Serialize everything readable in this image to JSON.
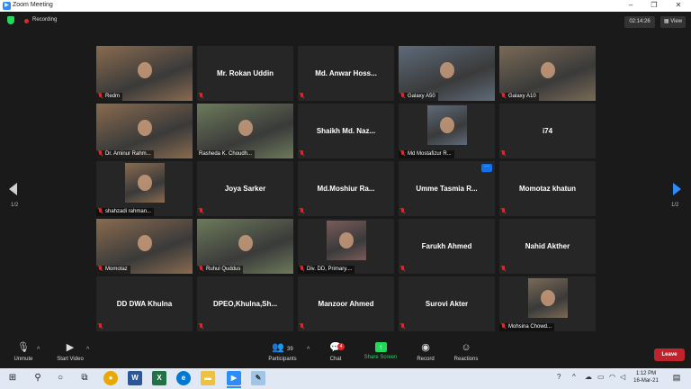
{
  "window": {
    "title": "Zoom Meeting"
  },
  "window_controls": {
    "minimize": "–",
    "restore": "❐",
    "close": "✕"
  },
  "status": {
    "recording_label": "Recording",
    "timer": "02:14:26",
    "view_label": "View",
    "view_icon": "grid-icon"
  },
  "gallery": {
    "page_left": "1/2",
    "page_right": "1/2",
    "tiles": [
      {
        "type": "video",
        "label": "Redm",
        "muted": true
      },
      {
        "type": "name",
        "name": "Mr. Rokan Uddin",
        "muted": true
      },
      {
        "type": "name",
        "name": "Md. Anwar Hoss...",
        "muted": true
      },
      {
        "type": "video",
        "label": "Galaxy A50",
        "muted": true
      },
      {
        "type": "video",
        "label": "Galaxy A10",
        "muted": true
      },
      {
        "type": "video",
        "label": "Dr. Aminur Rahm...",
        "muted": true
      },
      {
        "type": "video",
        "label": "Rasheda K. Choudh...",
        "muted": false,
        "active_speaker": true
      },
      {
        "type": "name",
        "name": "Shaikh  Md.  Naz...",
        "muted": true
      },
      {
        "type": "photo",
        "label": "Md Mostafizur R...",
        "muted": true
      },
      {
        "type": "name",
        "name": "i74",
        "muted": true
      },
      {
        "type": "photo",
        "label": "shahzadi rahman...",
        "muted": true
      },
      {
        "type": "name",
        "name": "Joya Sarker",
        "muted": true
      },
      {
        "type": "name",
        "name": "Md.Moshiur  Ra...",
        "muted": true
      },
      {
        "type": "name",
        "name": "Umme Tasmia R...",
        "muted": true,
        "more_button": "···"
      },
      {
        "type": "name",
        "name": "Momotaz khatun",
        "muted": true
      },
      {
        "type": "video",
        "label": "Momotaz",
        "muted": true
      },
      {
        "type": "video",
        "label": "Ruhul Quddus",
        "muted": true
      },
      {
        "type": "photo",
        "label": "Div. DD, Primary....",
        "muted": true
      },
      {
        "type": "name",
        "name": "Farukh Ahmed",
        "muted": true
      },
      {
        "type": "name",
        "name": "Nahid Akther",
        "muted": true
      },
      {
        "type": "name",
        "name": "DD DWA Khulna",
        "muted": true
      },
      {
        "type": "name",
        "name": "DPEO,Khulna,Sh...",
        "muted": true
      },
      {
        "type": "name",
        "name": "Manzoor Ahmed",
        "muted": true
      },
      {
        "type": "name",
        "name": "Surovi Akter",
        "muted": true
      },
      {
        "type": "photo",
        "label": "Mohsina Chowd...",
        "muted": true
      }
    ]
  },
  "toolbar": {
    "unmute": {
      "label": "Unmute",
      "icon": "mic-muted-icon"
    },
    "start_video": {
      "label": "Start Video",
      "icon": "video-off-icon"
    },
    "participants": {
      "label": "Participants",
      "count": "39",
      "icon": "participants-icon"
    },
    "chat": {
      "label": "Chat",
      "badge": "4",
      "icon": "chat-icon"
    },
    "share_screen": {
      "label": "Share Screen",
      "icon": "share-screen-icon"
    },
    "record": {
      "label": "Record",
      "icon": "record-icon"
    },
    "reactions": {
      "label": "Reactions",
      "icon": "reactions-icon"
    },
    "leave": {
      "label": "Leave"
    }
  },
  "taskbar": {
    "time": "1:12 PM",
    "date": "16-Mar-21",
    "apps": [
      "chrome-icon",
      "word-icon",
      "excel-icon",
      "edge-icon",
      "file-explorer-icon",
      "zoom-icon",
      "notepad-icon"
    ]
  },
  "colors": {
    "accent": "#2d8cff",
    "muted_red": "#e02828",
    "active_speaker": "#e3e31a",
    "share_green": "#23d959",
    "leave_red": "#c0232c"
  }
}
